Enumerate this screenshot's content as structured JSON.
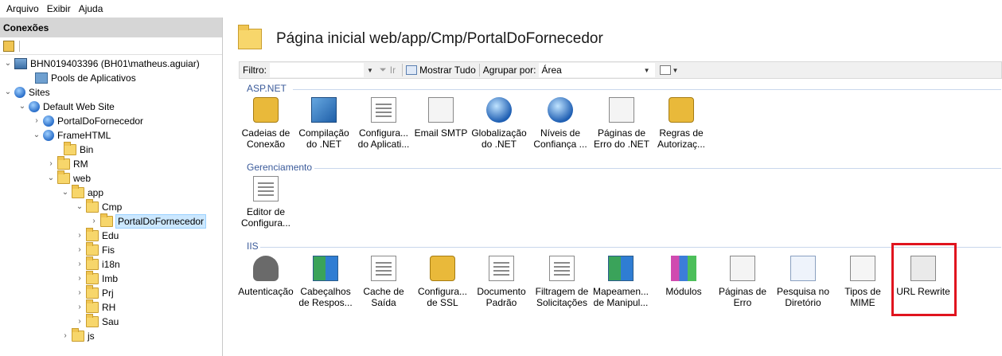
{
  "menu": [
    "Arquivo",
    "Exibir",
    "Ajuda"
  ],
  "connections": {
    "title": "Conexões",
    "tree": [
      {
        "label": "BHN019403396 (BH01\\matheus.aguiar)",
        "icon": "server-icon"
      },
      {
        "label": "Pools de Aplicativos",
        "icon": "app-pool-icon"
      },
      {
        "label": "Sites",
        "icon": "sites-icon"
      },
      {
        "label": "Default Web Site",
        "icon": "globe-icon"
      },
      {
        "label": "PortalDoFornecedor",
        "icon": "web-app-icon"
      },
      {
        "label": "FrameHTML",
        "icon": "web-app-icon"
      },
      {
        "label": "Bin",
        "icon": "folder-icon"
      },
      {
        "label": "RM",
        "icon": "folder-icon"
      },
      {
        "label": "web",
        "icon": "folder-icon"
      },
      {
        "label": "app",
        "icon": "folder-icon"
      },
      {
        "label": "Cmp",
        "icon": "folder-icon"
      },
      {
        "label": "PortalDoFornecedor",
        "icon": "folder-icon",
        "selected": true
      },
      {
        "label": "Edu",
        "icon": "folder-icon"
      },
      {
        "label": "Fis",
        "icon": "folder-icon"
      },
      {
        "label": "i18n",
        "icon": "folder-icon"
      },
      {
        "label": "Imb",
        "icon": "folder-icon"
      },
      {
        "label": "Prj",
        "icon": "folder-icon"
      },
      {
        "label": "RH",
        "icon": "folder-icon"
      },
      {
        "label": "Sau",
        "icon": "folder-icon"
      },
      {
        "label": "js",
        "icon": "folder-icon"
      }
    ]
  },
  "page": {
    "title": "Página inicial web/app/Cmp/PortalDoFornecedor"
  },
  "filterbar": {
    "filter_label": "Filtro:",
    "go_label": "Ir",
    "show_all_label": "Mostrar Tudo",
    "group_label": "Agrupar por:",
    "group_value": "Área"
  },
  "groups": {
    "aspnet": {
      "title": "ASP.NET",
      "items": [
        {
          "l1": "Cadeias de",
          "l2": "Conexão",
          "icon": "connection-strings-icon"
        },
        {
          "l1": "Compilação",
          "l2": "do .NET",
          "icon": "compilation-icon"
        },
        {
          "l1": "Configura...",
          "l2": "do Aplicati...",
          "icon": "app-settings-icon"
        },
        {
          "l1": "Email SMTP",
          "l2": "",
          "icon": "smtp-email-icon"
        },
        {
          "l1": "Globalização",
          "l2": "do .NET",
          "icon": "globalization-icon"
        },
        {
          "l1": "Níveis de",
          "l2": "Confiança ...",
          "icon": "trust-levels-icon"
        },
        {
          "l1": "Páginas de",
          "l2": "Erro do .NET",
          "icon": "error-pages-net-icon"
        },
        {
          "l1": "Regras de",
          "l2": "Autorizaç...",
          "icon": "authorization-rules-icon"
        }
      ]
    },
    "management": {
      "title": "Gerenciamento",
      "items": [
        {
          "l1": "Editor de",
          "l2": "Configura...",
          "icon": "config-editor-icon"
        }
      ]
    },
    "iis": {
      "title": "IIS",
      "items": [
        {
          "l1": "Autenticação",
          "l2": "",
          "icon": "authentication-icon"
        },
        {
          "l1": "Cabeçalhos",
          "l2": "de Respos...",
          "icon": "response-headers-icon"
        },
        {
          "l1": "Cache de",
          "l2": "Saída",
          "icon": "output-cache-icon"
        },
        {
          "l1": "Configura...",
          "l2": "de SSL",
          "icon": "ssl-settings-icon"
        },
        {
          "l1": "Documento",
          "l2": "Padrão",
          "icon": "default-document-icon"
        },
        {
          "l1": "Filtragem de",
          "l2": "Solicitações",
          "icon": "request-filtering-icon"
        },
        {
          "l1": "Mapeamen...",
          "l2": "de Manipul...",
          "icon": "handler-mappings-icon"
        },
        {
          "l1": "Módulos",
          "l2": "",
          "icon": "modules-icon"
        },
        {
          "l1": "Páginas de",
          "l2": "Erro",
          "icon": "error-pages-icon"
        },
        {
          "l1": "Pesquisa no",
          "l2": "Diretório",
          "icon": "directory-browsing-icon"
        },
        {
          "l1": "Tipos de",
          "l2": "MIME",
          "icon": "mime-types-icon"
        },
        {
          "l1": "URL Rewrite",
          "l2": "",
          "icon": "url-rewrite-icon",
          "highlighted": true
        }
      ]
    }
  },
  "colors": {
    "highlight": "#e0141e",
    "group_title": "#3a5a9a",
    "selection": "#cce8ff"
  }
}
